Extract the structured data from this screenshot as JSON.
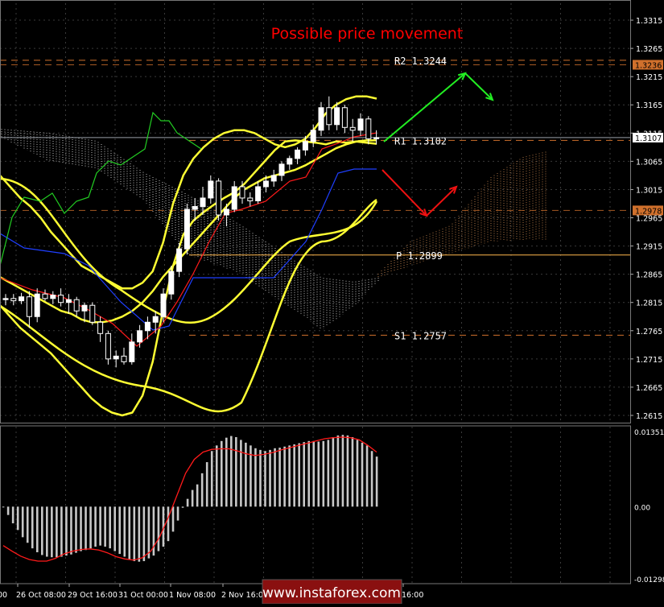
{
  "header": {
    "title": "Possible price movement",
    "title_color": "#ff0000"
  },
  "watermark": "www.instaforex.com",
  "colors": {
    "background": "#000000",
    "bull_candle": "#ffffff",
    "bear_candle": "#ffffff",
    "bollinger": "#ffff33",
    "kijun": "#1f3fff",
    "tenkan": "#ff1a1a",
    "chikou": "#22cc22",
    "cloud_a": "#ffffff",
    "cloud_b": "#e69a5a",
    "pivot_r": "#d0702c",
    "pivot_p": "#ffb74d",
    "arrow_up": "#22ee22",
    "arrow_down": "#ee1111",
    "macd_hist": "#c8c8c8",
    "macd_signal": "#ff1a1a"
  },
  "chart_data": [
    {
      "type": "candlestick",
      "title": "Possible price movement",
      "y_axis": {
        "ticks": [
          "1.3315",
          "1.3265",
          "1.3215",
          "1.3165",
          "1.3115",
          "1.3065",
          "1.3015",
          "1.2965",
          "1.2915",
          "1.2865",
          "1.2815",
          "1.2765",
          "1.2715",
          "1.2665",
          "1.2615"
        ],
        "ylim": [
          1.2605,
          1.3345
        ],
        "current_price": "1.3107",
        "level_tags": [
          "1.3236",
          "1.2978"
        ]
      },
      "x_axis": {
        "tick_labels": [
          "00",
          "26 Oct 08:00",
          "29 Oct 16:00",
          "31 Oct 00:00",
          "1 Nov 08:00",
          "2 Nov 16:00",
          "16:00"
        ],
        "tick_index": [
          0,
          3,
          8,
          13,
          18,
          23,
          42
        ]
      },
      "pivot_levels": [
        {
          "label": "R2 1.3244",
          "value": 1.3244,
          "name": "R2"
        },
        {
          "label": "R1 1.3102",
          "value": 1.3102,
          "name": "R1"
        },
        {
          "label": "P 1.2899",
          "value": 1.2899,
          "name": "P"
        },
        {
          "label": "S1 1.2757",
          "value": 1.2757,
          "name": "S1"
        }
      ],
      "candles": [
        {
          "o": 1.282,
          "h": 1.283,
          "l": 1.281,
          "c": 1.2822
        },
        {
          "o": 1.2822,
          "h": 1.283,
          "l": 1.281,
          "c": 1.2818
        },
        {
          "o": 1.2818,
          "h": 1.2832,
          "l": 1.2812,
          "c": 1.2825
        },
        {
          "o": 1.2825,
          "h": 1.2835,
          "l": 1.277,
          "c": 1.279
        },
        {
          "o": 1.279,
          "h": 1.284,
          "l": 1.278,
          "c": 1.283
        },
        {
          "o": 1.283,
          "h": 1.2838,
          "l": 1.2818,
          "c": 1.2822
        },
        {
          "o": 1.2822,
          "h": 1.2835,
          "l": 1.2812,
          "c": 1.2828
        },
        {
          "o": 1.2828,
          "h": 1.284,
          "l": 1.2808,
          "c": 1.2815
        },
        {
          "o": 1.2815,
          "h": 1.283,
          "l": 1.2795,
          "c": 1.282
        },
        {
          "o": 1.282,
          "h": 1.2825,
          "l": 1.279,
          "c": 1.28
        },
        {
          "o": 1.28,
          "h": 1.2815,
          "l": 1.278,
          "c": 1.281
        },
        {
          "o": 1.281,
          "h": 1.2815,
          "l": 1.2775,
          "c": 1.278
        },
        {
          "o": 1.278,
          "h": 1.279,
          "l": 1.2745,
          "c": 1.276
        },
        {
          "o": 1.276,
          "h": 1.2765,
          "l": 1.2705,
          "c": 1.2715
        },
        {
          "o": 1.2715,
          "h": 1.273,
          "l": 1.27,
          "c": 1.272
        },
        {
          "o": 1.272,
          "h": 1.2735,
          "l": 1.2705,
          "c": 1.271
        },
        {
          "o": 1.271,
          "h": 1.276,
          "l": 1.2705,
          "c": 1.2745
        },
        {
          "o": 1.2745,
          "h": 1.2775,
          "l": 1.2735,
          "c": 1.2765
        },
        {
          "o": 1.2765,
          "h": 1.279,
          "l": 1.275,
          "c": 1.278
        },
        {
          "o": 1.278,
          "h": 1.28,
          "l": 1.276,
          "c": 1.279
        },
        {
          "o": 1.279,
          "h": 1.284,
          "l": 1.278,
          "c": 1.283
        },
        {
          "o": 1.283,
          "h": 1.288,
          "l": 1.282,
          "c": 1.287
        },
        {
          "o": 1.287,
          "h": 1.292,
          "l": 1.286,
          "c": 1.291
        },
        {
          "o": 1.291,
          "h": 1.299,
          "l": 1.29,
          "c": 1.298
        },
        {
          "o": 1.298,
          "h": 1.3,
          "l": 1.296,
          "c": 1.2985
        },
        {
          "o": 1.2985,
          "h": 1.302,
          "l": 1.297,
          "c": 1.3
        },
        {
          "o": 1.3,
          "h": 1.304,
          "l": 1.299,
          "c": 1.303
        },
        {
          "o": 1.303,
          "h": 1.3035,
          "l": 1.296,
          "c": 1.297
        },
        {
          "o": 1.297,
          "h": 1.299,
          "l": 1.295,
          "c": 1.298
        },
        {
          "o": 1.298,
          "h": 1.303,
          "l": 1.2975,
          "c": 1.302
        },
        {
          "o": 1.302,
          "h": 1.303,
          "l": 1.299,
          "c": 1.3
        },
        {
          "o": 1.3,
          "h": 1.301,
          "l": 1.2985,
          "c": 1.2995
        },
        {
          "o": 1.2995,
          "h": 1.303,
          "l": 1.299,
          "c": 1.302
        },
        {
          "o": 1.302,
          "h": 1.304,
          "l": 1.301,
          "c": 1.303
        },
        {
          "o": 1.303,
          "h": 1.305,
          "l": 1.302,
          "c": 1.304
        },
        {
          "o": 1.304,
          "h": 1.3065,
          "l": 1.303,
          "c": 1.306
        },
        {
          "o": 1.306,
          "h": 1.3075,
          "l": 1.305,
          "c": 1.307
        },
        {
          "o": 1.307,
          "h": 1.309,
          "l": 1.306,
          "c": 1.3085
        },
        {
          "o": 1.3085,
          "h": 1.311,
          "l": 1.3075,
          "c": 1.31
        },
        {
          "o": 1.31,
          "h": 1.313,
          "l": 1.309,
          "c": 1.312
        },
        {
          "o": 1.312,
          "h": 1.317,
          "l": 1.311,
          "c": 1.316
        },
        {
          "o": 1.316,
          "h": 1.318,
          "l": 1.312,
          "c": 1.313
        },
        {
          "o": 1.313,
          "h": 1.317,
          "l": 1.312,
          "c": 1.316
        },
        {
          "o": 1.316,
          "h": 1.3165,
          "l": 1.3115,
          "c": 1.3125
        },
        {
          "o": 1.3125,
          "h": 1.314,
          "l": 1.31,
          "c": 1.312
        },
        {
          "o": 1.312,
          "h": 1.315,
          "l": 1.311,
          "c": 1.314
        },
        {
          "o": 1.314,
          "h": 1.3145,
          "l": 1.3095,
          "c": 1.3105
        },
        {
          "o": 1.3105,
          "h": 1.312,
          "l": 1.3095,
          "c": 1.3107
        }
      ],
      "bollinger_upper": [
        1.304,
        1.302,
        1.3,
        1.2985,
        1.2965,
        1.294,
        1.292,
        1.29,
        1.288,
        1.287,
        1.286,
        1.285,
        1.284,
        1.284,
        1.285,
        1.287,
        1.292,
        1.299,
        1.304,
        1.307,
        1.309,
        1.3105,
        1.3115,
        1.312,
        1.312,
        1.3115,
        1.3105,
        1.3095,
        1.309,
        1.3095,
        1.3105,
        1.3125,
        1.315,
        1.3165,
        1.3175,
        1.318,
        1.318,
        1.3176
      ],
      "bollinger_mid": [
        1.286,
        1.285,
        1.284,
        1.283,
        1.282,
        1.281,
        1.28,
        1.2795,
        1.2785,
        1.278,
        1.278,
        1.2783,
        1.279,
        1.28,
        1.2815,
        1.2835,
        1.286,
        1.288,
        1.29,
        1.292,
        1.294,
        1.296,
        1.298,
        1.3,
        1.3015,
        1.3025,
        1.3035,
        1.304,
        1.3045,
        1.305,
        1.3058,
        1.3068,
        1.3078,
        1.3088,
        1.3095,
        1.31,
        1.3102,
        1.3102
      ],
      "bollinger_lower": [
        1.281,
        1.279,
        1.277,
        1.2755,
        1.274,
        1.2725,
        1.2705,
        1.2685,
        1.2665,
        1.2645,
        1.263,
        1.262,
        1.2615,
        1.262,
        1.265,
        1.271,
        1.28,
        1.288,
        1.2935,
        1.296,
        1.2975,
        1.2988,
        1.3,
        1.301,
        1.3025,
        1.3045,
        1.3065,
        1.3085,
        1.31,
        1.3102,
        1.31,
        1.3098,
        1.3095,
        1.31,
        1.3098,
        1.31,
        1.3098,
        1.3096
      ],
      "macd": {
        "yticks": [
          "0.01351",
          "0.00",
          "-0.01298"
        ],
        "ylim": [
          -0.01298,
          0.01351
        ],
        "histogram": [
          -0.0001,
          -0.0015,
          -0.003,
          -0.0042,
          -0.0055,
          -0.0065,
          -0.0075,
          -0.0082,
          -0.0087,
          -0.009,
          -0.0091,
          -0.0091,
          -0.009,
          -0.0088,
          -0.0086,
          -0.0083,
          -0.008,
          -0.0078,
          -0.0075,
          -0.0072,
          -0.007,
          -0.0072,
          -0.0075,
          -0.008,
          -0.0085,
          -0.009,
          -0.0095,
          -0.0098,
          -0.0099,
          -0.0098,
          -0.0093,
          -0.0088,
          -0.008,
          -0.0072,
          -0.0062,
          -0.0045,
          -0.0025,
          -0.0002,
          0.0014,
          0.003,
          0.004,
          0.006,
          0.008,
          0.01,
          0.011,
          0.0118,
          0.0124,
          0.0127,
          0.0125,
          0.012,
          0.0115,
          0.011,
          0.0105,
          0.0102,
          0.01,
          0.0102,
          0.0105,
          0.0106,
          0.0108,
          0.011,
          0.0112,
          0.0114,
          0.0116,
          0.0118,
          0.0118,
          0.0117,
          0.0118,
          0.012,
          0.0125,
          0.0128,
          0.0129,
          0.0128,
          0.0125,
          0.012,
          0.0115,
          0.011,
          0.01,
          0.009
        ],
        "signal": [
          -0.007,
          -0.008,
          -0.0089,
          -0.0095,
          -0.0098,
          -0.0098,
          -0.0093,
          -0.0085,
          -0.008,
          -0.0077,
          -0.0076,
          -0.0078,
          -0.0083,
          -0.009,
          -0.0094,
          -0.0096,
          -0.0092,
          -0.008,
          -0.0055,
          -0.002,
          0.002,
          0.006,
          0.0085,
          0.0098,
          0.0103,
          0.0104,
          0.0104,
          0.01,
          0.0095,
          0.0092,
          0.0094,
          0.0097,
          0.0102,
          0.0106,
          0.011,
          0.0114,
          0.0118,
          0.0122,
          0.0124,
          0.0125,
          0.0124,
          0.012,
          0.011,
          0.0098
        ]
      }
    }
  ]
}
